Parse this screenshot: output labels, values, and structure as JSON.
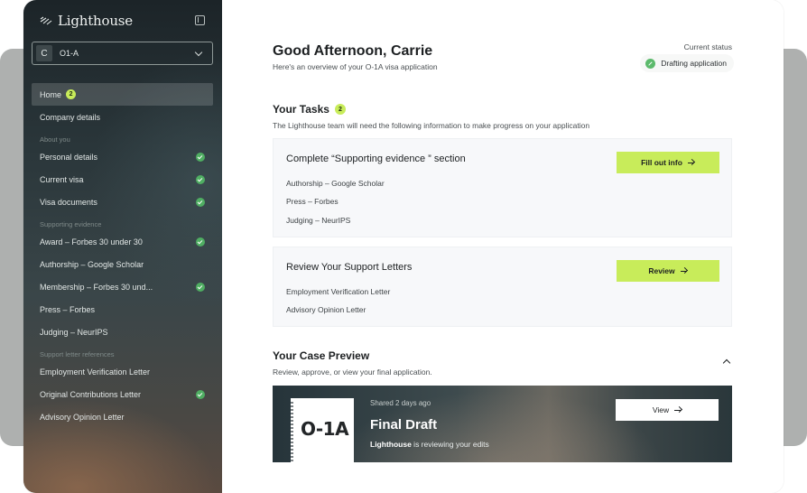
{
  "brand": {
    "name": "Lighthouse"
  },
  "selector": {
    "badge": "C",
    "label": "O1-A"
  },
  "sidebar": {
    "home": {
      "label": "Home",
      "count": "2"
    },
    "company": {
      "label": "Company details"
    },
    "about_section": "About you",
    "about_items": [
      {
        "label": "Personal details",
        "done": true
      },
      {
        "label": "Current visa",
        "done": true
      },
      {
        "label": "Visa documents",
        "done": true
      }
    ],
    "evidence_section": "Supporting evidence",
    "evidence_items": [
      {
        "label": "Award – Forbes 30 under 30",
        "done": true
      },
      {
        "label": "Authorship – Google Scholar",
        "done": false
      },
      {
        "label": "Membership – Forbes 30 und...",
        "done": true
      },
      {
        "label": "Press – Forbes",
        "done": false
      },
      {
        "label": "Judging – NeurIPS",
        "done": false
      }
    ],
    "letters_section": "Support letter references",
    "letter_items": [
      {
        "label": "Employment Verification Letter",
        "done": false
      },
      {
        "label": "Original Contributions Letter",
        "done": true
      },
      {
        "label": "Advisory Opinion Letter",
        "done": false
      }
    ]
  },
  "header": {
    "greeting": "Good Afternoon, Carrie",
    "subtitle": "Here's an overview of your O-1A visa application",
    "status_label": "Current status",
    "status_value": "Drafting application"
  },
  "tasks": {
    "title": "Your Tasks",
    "count": "2",
    "subtitle": "The Lighthouse team will need the following information to make progress on your application",
    "cards": [
      {
        "title": "Complete “Supporting evidence ” section",
        "items": [
          "Authorship – Google Scholar",
          "Press – Forbes",
          "Judging – NeurIPS"
        ],
        "button": "Fill out info"
      },
      {
        "title": "Review Your Support Letters",
        "items": [
          "Employment Verification Letter",
          "Advisory Opinion Letter"
        ],
        "button": "Review"
      }
    ]
  },
  "preview": {
    "title": "Your Case Preview",
    "subtitle": "Review, approve, or view your final application.",
    "doc_label": "O-1A",
    "shared": "Shared 2 days ago",
    "draft_title": "Final Draft",
    "note_strong": "Lighthouse",
    "note_rest": " is reviewing your edits",
    "button": "View"
  },
  "colors": {
    "accent": "#c8ec5a",
    "check": "#4fae62"
  }
}
